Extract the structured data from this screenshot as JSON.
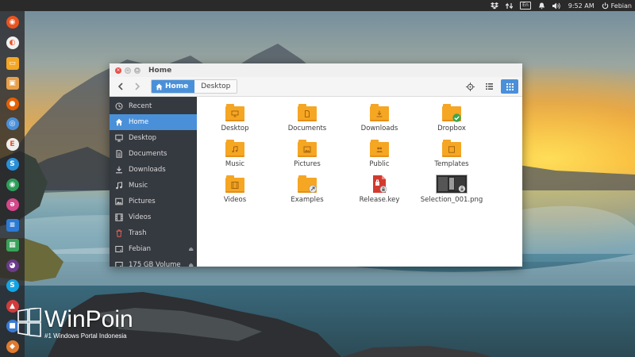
{
  "top_panel": {
    "language": "En",
    "clock": "9:52 AM",
    "user": "Febian",
    "indicators": [
      "dropbox-icon",
      "network-icon",
      "keyboard-layout",
      "notification-icon",
      "volume-icon",
      "clock",
      "power-icon"
    ]
  },
  "launcher": {
    "items": [
      {
        "name": "ubuntu-dash-icon",
        "bg": "#e95420"
      },
      {
        "name": "disk-usage-icon",
        "bg": "#f1f1f1"
      },
      {
        "name": "files-icon",
        "bg": "#f5a623"
      },
      {
        "name": "software-center-icon",
        "bg": "#e8a04a"
      },
      {
        "name": "firefox-icon",
        "bg": "#e66000"
      },
      {
        "name": "chromium-icon",
        "bg": "#4a90d9"
      },
      {
        "name": "e-app-icon",
        "bg": "#eeeeee"
      },
      {
        "name": "swirl-app-icon",
        "bg": "#2a8fd6"
      },
      {
        "name": "eye-app-icon",
        "bg": "#2e9e5b"
      },
      {
        "name": "pink-app-icon",
        "bg": "#d6478c"
      },
      {
        "name": "writer-icon",
        "bg": "#2b7bd6"
      },
      {
        "name": "calc-icon",
        "bg": "#3aa35a"
      },
      {
        "name": "purple-app-icon",
        "bg": "#6b3b8c"
      },
      {
        "name": "skype-icon",
        "bg": "#12a5e6"
      },
      {
        "name": "red-app-icon",
        "bg": "#d13b3b"
      },
      {
        "name": "blue-app-icon",
        "bg": "#3a7bd5"
      },
      {
        "name": "orange-app-icon",
        "bg": "#e07a2f"
      }
    ]
  },
  "window": {
    "title": "Home",
    "breadcrumbs": [
      "Home",
      "Desktop"
    ],
    "sidebar": [
      {
        "label": "Recent",
        "icon": "clock-icon"
      },
      {
        "label": "Home",
        "icon": "home-icon",
        "selected": true
      },
      {
        "label": "Desktop",
        "icon": "desktop-icon"
      },
      {
        "label": "Documents",
        "icon": "document-icon"
      },
      {
        "label": "Downloads",
        "icon": "download-icon"
      },
      {
        "label": "Music",
        "icon": "music-icon"
      },
      {
        "label": "Pictures",
        "icon": "picture-icon"
      },
      {
        "label": "Videos",
        "icon": "video-icon"
      },
      {
        "label": "Trash",
        "icon": "trash-icon"
      },
      {
        "label": "Febian",
        "icon": "drive-icon",
        "eject": true
      },
      {
        "label": "175 GB Volume",
        "icon": "drive-icon",
        "eject": true
      }
    ],
    "files": [
      {
        "label": "Desktop",
        "kind": "folder",
        "mark": "desktop"
      },
      {
        "label": "Documents",
        "kind": "folder",
        "mark": "document"
      },
      {
        "label": "Downloads",
        "kind": "folder",
        "mark": "download"
      },
      {
        "label": "Dropbox",
        "kind": "folder",
        "mark": "dropbox"
      },
      {
        "label": "Music",
        "kind": "folder",
        "mark": "music"
      },
      {
        "label": "Pictures",
        "kind": "folder",
        "mark": "picture"
      },
      {
        "label": "Public",
        "kind": "folder",
        "mark": "public"
      },
      {
        "label": "Templates",
        "kind": "folder",
        "mark": "template"
      },
      {
        "label": "Videos",
        "kind": "folder",
        "mark": "video"
      },
      {
        "label": "Examples",
        "kind": "folder",
        "mark": "link"
      },
      {
        "label": "Release.key",
        "kind": "file-key",
        "mark": "key"
      },
      {
        "label": "Selection_001.png",
        "kind": "file-image",
        "mark": "image"
      }
    ]
  },
  "watermark": {
    "title": "WinPoin",
    "subtitle": "#1 Windows Portal Indonesia"
  },
  "colors": {
    "accent": "#4a90d9",
    "folder": "#f5a623",
    "sidebar_bg": "#353940",
    "panel_bg": "#2a2a2a"
  }
}
